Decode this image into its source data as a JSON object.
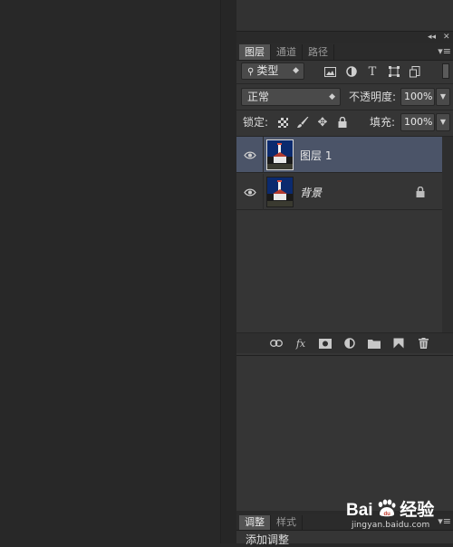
{
  "panel_controls": {
    "collapse": "◂◂",
    "close": "✕"
  },
  "tabs": [
    {
      "label": "图层",
      "active": true
    },
    {
      "label": "通道",
      "active": false
    },
    {
      "label": "路径",
      "active": false
    }
  ],
  "filter": {
    "kind_label": "类型",
    "icons": [
      "image-filter-icon",
      "adjustment-filter-icon",
      "type-filter-icon",
      "shape-filter-icon",
      "smart-object-filter-icon"
    ]
  },
  "blend": {
    "mode": "正常",
    "opacity_label": "不透明度:",
    "opacity_value": "100%"
  },
  "lock": {
    "label": "锁定:",
    "fill_label": "填充:",
    "fill_value": "100%"
  },
  "layers": [
    {
      "name": "图层 1",
      "selected": true,
      "visible": true,
      "locked": false,
      "italic": false
    },
    {
      "name": "背景",
      "selected": false,
      "visible": true,
      "locked": true,
      "italic": true
    }
  ],
  "footer_icons": [
    "link-layers-icon",
    "fx-icon",
    "layer-mask-icon",
    "adjustment-layer-icon",
    "new-group-icon",
    "new-layer-icon",
    "delete-layer-icon"
  ],
  "footer_fx": "fx",
  "bottom_tabs": [
    {
      "label": "调整",
      "active": true
    },
    {
      "label": "样式",
      "active": false
    }
  ],
  "add_adjustment": "添加调整",
  "watermark": {
    "brand_left": "Bai",
    "brand_right": "经验",
    "url": "jingyan.baidu.com"
  },
  "colors": {
    "selected_row": "#4b5468",
    "panel_bg": "#353535",
    "canvas_bg": "#282828"
  }
}
